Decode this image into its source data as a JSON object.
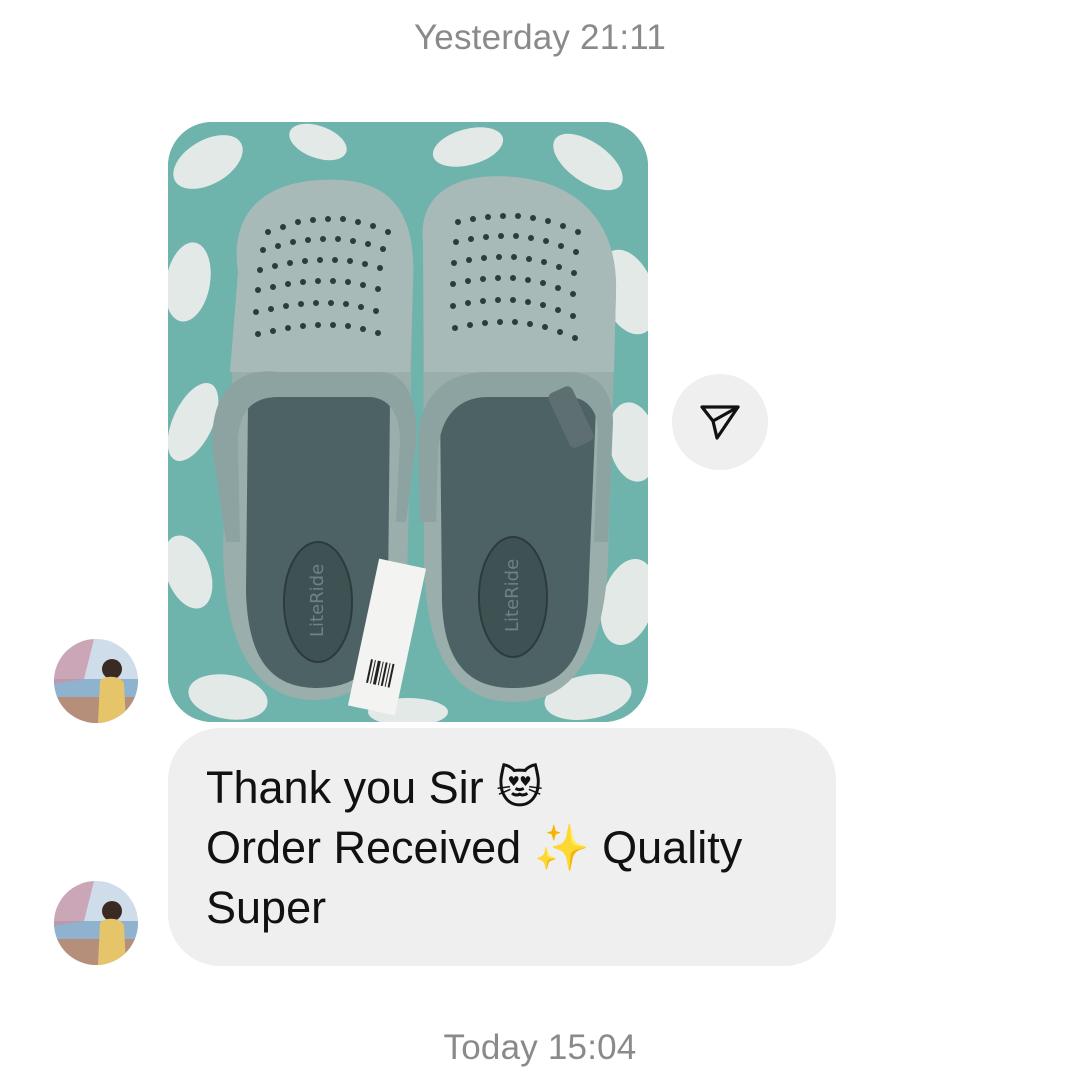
{
  "conversation": {
    "timestamp_top": "Yesterday 21:11",
    "timestamp_bottom": "Today 15:04"
  },
  "image_message": {
    "description_icon": "photo-of-clogs",
    "sole_text": "LiteRide"
  },
  "share_button": {
    "icon": "paper-plane-icon"
  },
  "text_message": {
    "lines": [
      "Thank you Sir 😻",
      "Order Received ✨ Quality",
      "Super"
    ]
  },
  "colors": {
    "timestamp": "#8a8a8a",
    "bubble_bg": "#efefef",
    "share_bg": "#efefef",
    "text": "#111111",
    "background": "#ffffff"
  }
}
